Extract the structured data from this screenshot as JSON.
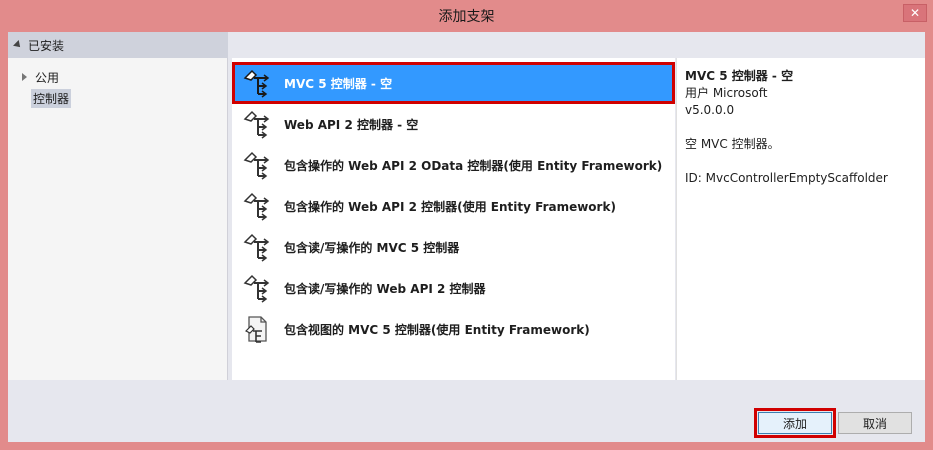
{
  "window": {
    "title": "添加支架",
    "close_label": "✕"
  },
  "left": {
    "header": "已安装",
    "tree": [
      {
        "label": "公用",
        "expandable": true,
        "selected": false
      },
      {
        "label": "控制器",
        "expandable": false,
        "selected": true
      }
    ]
  },
  "list": {
    "items": [
      {
        "label": "MVC 5 控制器 - 空",
        "icon": "controller-icon",
        "selected": true
      },
      {
        "label": "Web API 2 控制器 - 空",
        "icon": "controller-icon",
        "selected": false
      },
      {
        "label": "包含操作的 Web API 2 OData 控制器(使用 Entity Framework)",
        "icon": "controller-icon",
        "selected": false
      },
      {
        "label": "包含操作的 Web API 2 控制器(使用 Entity Framework)",
        "icon": "controller-icon",
        "selected": false
      },
      {
        "label": "包含读/写操作的 MVC 5 控制器",
        "icon": "controller-icon",
        "selected": false
      },
      {
        "label": "包含读/写操作的 Web API 2 控制器",
        "icon": "controller-icon",
        "selected": false
      },
      {
        "label": "包含视图的 MVC 5 控制器(使用 Entity Framework)",
        "icon": "controller-view-icon",
        "selected": false
      }
    ]
  },
  "details": {
    "title": "MVC 5 控制器 - 空",
    "author": "用户 Microsoft",
    "version": "v5.0.0.0",
    "description": "空 MVC 控制器。",
    "id": "ID: MvcControllerEmptyScaffolder"
  },
  "buttons": {
    "add": "添加",
    "cancel": "取消"
  },
  "colors": {
    "titlebar": "#e28b8b",
    "selection": "#3399ff",
    "highlight_border": "#d00000"
  }
}
